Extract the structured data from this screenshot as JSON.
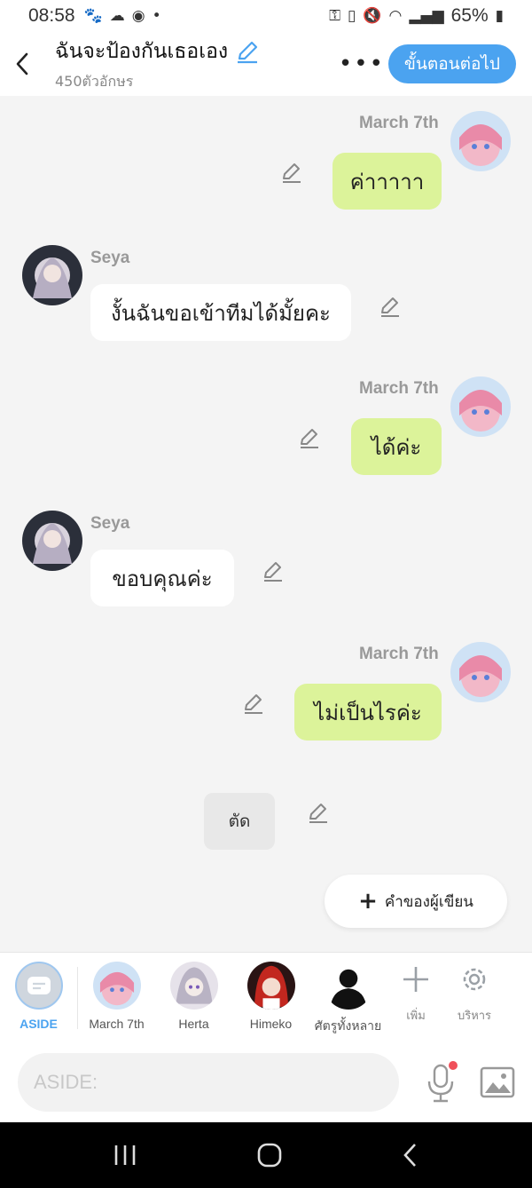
{
  "status_bar": {
    "time": "08:58",
    "battery": "65%",
    "left_icons": [
      "paw-icon",
      "cloud-icon",
      "app-icon",
      "dot-icon"
    ],
    "right_icons": [
      "key-icon",
      "battery-saver-icon",
      "mute-icon",
      "wifi-icon",
      "signal-icon",
      "battery-icon"
    ]
  },
  "header": {
    "title": "ฉันจะป้องกันเธอเอง",
    "subtitle": "450ตัวอักษร",
    "next_label": "ขั้นตอนต่อไป"
  },
  "messages": [
    {
      "side": "right",
      "name": "March 7th",
      "text": "ค่าาาาา"
    },
    {
      "side": "left",
      "name": "Seya",
      "text": "งั้นฉันขอเข้าทีมได้มั้ยคะ"
    },
    {
      "side": "right",
      "name": "March 7th",
      "text": "ได้ค่ะ"
    },
    {
      "side": "left",
      "name": "Seya",
      "text": "ขอบคุณค่ะ"
    },
    {
      "side": "right",
      "name": "March 7th",
      "text": "ไม่เป็นไรค่ะ"
    }
  ],
  "cut_label": "ตัด",
  "author_button": "คำของผู้เขียน",
  "characters": [
    {
      "label": "ASIDE",
      "active": true
    },
    {
      "label": "March 7th"
    },
    {
      "label": "Herta"
    },
    {
      "label": "Himeko"
    },
    {
      "label": "ศัตรูทั้งหลาย"
    }
  ],
  "tools": {
    "add_label": "เพิ่ม",
    "manage_label": "บริหาร"
  },
  "input": {
    "placeholder": "ASIDE:"
  },
  "colors": {
    "accent": "#4ba3f0",
    "outgoing_bubble": "#dcf39a",
    "incoming_bubble": "#ffffff",
    "background": "#f4f4f4"
  }
}
